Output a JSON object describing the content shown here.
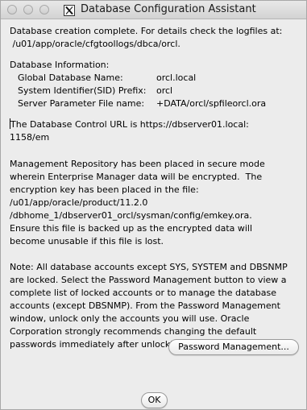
{
  "window": {
    "title": "Database Configuration Assistant"
  },
  "message": {
    "intro_lines": [
      "Database creation complete. For details check the logfiles at:",
      " /u01/app/oracle/cfgtoollogs/dbca/orcl."
    ],
    "db_info_heading": "Database Information:",
    "db_info": [
      {
        "label": "Global Database Name:",
        "value": "orcl.local"
      },
      {
        "label": "System Identifier(SID) Prefix:",
        "value": "orcl"
      },
      {
        "label": "Server Parameter File name:",
        "value": "+DATA/orcl/spfileorcl.ora"
      }
    ],
    "control_url_lines": [
      "The Database Control URL is https://dbserver01.local:",
      "1158/em"
    ],
    "repository_lines": [
      "Management Repository has been placed in secure mode",
      "wherein Enterprise Manager data will be encrypted.  The",
      "encryption key has been placed in the file:",
      "/u01/app/oracle/product/11.2.0",
      "/dbhome_1/dbserver01_orcl/sysman/config/emkey.ora.",
      "Ensure this file is backed up as the encrypted data will",
      "become unusable if this file is lost."
    ],
    "note_lines": [
      "Note: All database accounts except SYS, SYSTEM and DBSNMP",
      "are locked. Select the Password Management button to view a",
      "complete list of locked accounts or to manage the database",
      "accounts (except DBSNMP). From the Password Management",
      "window, unlock only the accounts you will use. Oracle",
      "Corporation strongly recommends changing the default",
      "passwords immediately after unlocking the account."
    ]
  },
  "buttons": {
    "password_management": "Password Management...",
    "ok": "OK"
  }
}
